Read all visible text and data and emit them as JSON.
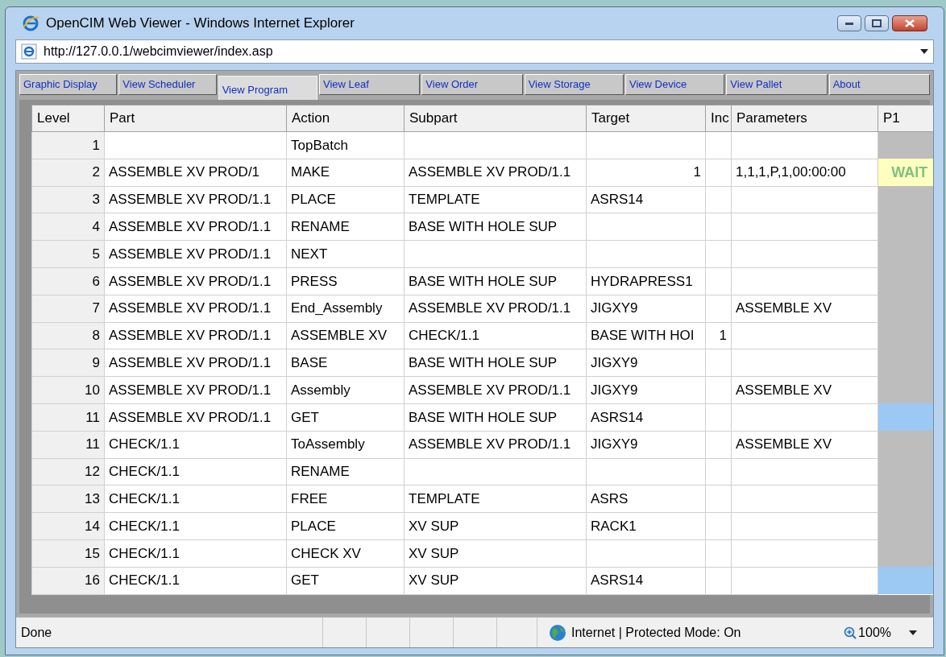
{
  "window": {
    "title": "OpenCIM Web Viewer - Windows Internet Explorer"
  },
  "address_bar": {
    "value": "http://127.0.0.1/webcimviewer/index.asp"
  },
  "tabs": [
    {
      "label": "Graphic Display",
      "selected": false
    },
    {
      "label": "View Scheduler",
      "selected": false
    },
    {
      "label": "View Program",
      "selected": true
    },
    {
      "label": "View Leaf",
      "selected": false
    },
    {
      "label": "View Order",
      "selected": false
    },
    {
      "label": "View Storage",
      "selected": false
    },
    {
      "label": "View Device",
      "selected": false
    },
    {
      "label": "View Pallet",
      "selected": false
    },
    {
      "label": "About",
      "selected": false
    }
  ],
  "table": {
    "columns": [
      "Level",
      "Part",
      "Action",
      "Subpart",
      "Target",
      "Inc",
      "Parameters",
      "P1"
    ],
    "rows": [
      {
        "cells": [
          "1",
          "",
          "TopBatch",
          "",
          "",
          "",
          ""
        ],
        "p1": {
          "kind": "idle"
        }
      },
      {
        "cells": [
          "2",
          "ASSEMBLE XV PROD/1",
          "MAKE",
          "ASSEMBLE XV PROD/1.1",
          "1",
          "",
          "1,1,1,P,1,00:00:00"
        ],
        "p1": {
          "kind": "wait",
          "text": "WAIT"
        }
      },
      {
        "cells": [
          "3",
          "ASSEMBLE XV PROD/1.1",
          "PLACE",
          "TEMPLATE",
          "ASRS14",
          "",
          ""
        ],
        "p1": {
          "kind": "idle"
        }
      },
      {
        "cells": [
          "4",
          "ASSEMBLE XV PROD/1.1",
          "RENAME",
          "BASE WITH HOLE SUP",
          "",
          "",
          ""
        ],
        "p1": {
          "kind": "idle"
        }
      },
      {
        "cells": [
          "5",
          "ASSEMBLE XV PROD/1.1",
          "NEXT",
          "",
          "",
          "",
          ""
        ],
        "p1": {
          "kind": "idle"
        }
      },
      {
        "cells": [
          "6",
          "ASSEMBLE XV PROD/1.1",
          "PRESS",
          "BASE WITH HOLE SUP",
          "HYDRAPRESS1",
          "",
          ""
        ],
        "p1": {
          "kind": "idle"
        }
      },
      {
        "cells": [
          "7",
          "ASSEMBLE XV PROD/1.1",
          "End_Assembly",
          "ASSEMBLE XV PROD/1.1",
          "JIGXY9",
          "",
          "ASSEMBLE XV"
        ],
        "p1": {
          "kind": "idle"
        }
      },
      {
        "cells": [
          "8",
          "ASSEMBLE XV PROD/1.1",
          "ASSEMBLE XV",
          "CHECK/1.1",
          "BASE WITH HOI",
          "1",
          ""
        ],
        "p1": {
          "kind": "idle"
        }
      },
      {
        "cells": [
          "9",
          "ASSEMBLE XV PROD/1.1",
          "BASE",
          "BASE WITH HOLE SUP",
          "JIGXY9",
          "",
          ""
        ],
        "p1": {
          "kind": "idle"
        }
      },
      {
        "cells": [
          "10",
          "ASSEMBLE XV PROD/1.1",
          "Assembly",
          "ASSEMBLE XV PROD/1.1",
          "JIGXY9",
          "",
          "ASSEMBLE XV"
        ],
        "p1": {
          "kind": "idle"
        }
      },
      {
        "cells": [
          "11",
          "ASSEMBLE XV PROD/1.1",
          "GET",
          "BASE WITH HOLE SUP",
          "ASRS14",
          "",
          ""
        ],
        "p1": {
          "kind": "active"
        }
      },
      {
        "cells": [
          "11",
          "CHECK/1.1",
          "ToAssembly",
          "ASSEMBLE XV PROD/1.1",
          "JIGXY9",
          "",
          "ASSEMBLE XV"
        ],
        "p1": {
          "kind": "idle"
        }
      },
      {
        "cells": [
          "12",
          "CHECK/1.1",
          "RENAME",
          "",
          "",
          "",
          ""
        ],
        "p1": {
          "kind": "idle"
        }
      },
      {
        "cells": [
          "13",
          "CHECK/1.1",
          "FREE",
          "TEMPLATE",
          "ASRS",
          "",
          ""
        ],
        "p1": {
          "kind": "idle"
        }
      },
      {
        "cells": [
          "14",
          "CHECK/1.1",
          "PLACE",
          "XV SUP",
          "RACK1",
          "",
          ""
        ],
        "p1": {
          "kind": "idle"
        }
      },
      {
        "cells": [
          "15",
          "CHECK/1.1",
          "CHECK XV",
          "XV SUP",
          "",
          "",
          ""
        ],
        "p1": {
          "kind": "idle"
        }
      },
      {
        "cells": [
          "16",
          "CHECK/1.1",
          "GET",
          "XV SUP",
          "ASRS14",
          "",
          ""
        ],
        "p1": {
          "kind": "active"
        }
      }
    ]
  },
  "status_bar": {
    "status": "Done",
    "zone": "Internet | Protected Mode: On",
    "zoom": "100%"
  }
}
